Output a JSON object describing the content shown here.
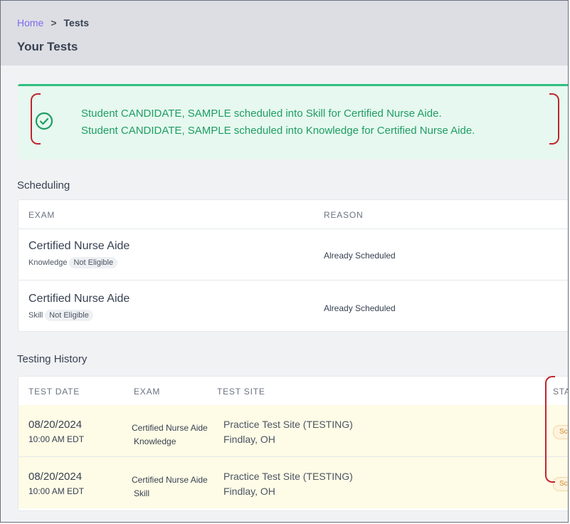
{
  "breadcrumb": {
    "home": "Home",
    "separator": ">",
    "current": "Tests"
  },
  "page_title": "Your Tests",
  "alert": {
    "icon": "check-circle-icon",
    "color": "#1f9d63",
    "messages": [
      "Student CANDIDATE, SAMPLE scheduled into Skill for Certified Nurse Aide.",
      "Student CANDIDATE, SAMPLE scheduled into Knowledge for Certified Nurse Aide."
    ]
  },
  "scheduling": {
    "title": "Scheduling",
    "headers": {
      "exam": "EXAM",
      "reason": "REASON"
    },
    "rows": [
      {
        "exam": "Certified Nurse Aide",
        "type": "Knowledge",
        "badge": "Not Eligible",
        "reason": "Already Scheduled"
      },
      {
        "exam": "Certified Nurse Aide",
        "type": "Skill",
        "badge": "Not Eligible",
        "reason": "Already Scheduled"
      }
    ]
  },
  "history": {
    "title": "Testing History",
    "headers": {
      "date": "TEST DATE",
      "exam": "EXAM",
      "site": "TEST SITE",
      "status": "STAT"
    },
    "rows": [
      {
        "date": "08/20/2024",
        "time": "10:00 AM EDT",
        "exam": "Certified Nurse Aide",
        "type": "Knowledge",
        "site": "Practice Test Site (TESTING)",
        "location": "Findlay, OH",
        "status": "Sch"
      },
      {
        "date": "08/20/2024",
        "time": "10:00 AM EDT",
        "exam": "Certified Nurse Aide",
        "type": "Skill",
        "site": "Practice Test Site (TESTING)",
        "location": "Findlay, OH",
        "status": "Sch"
      }
    ]
  },
  "colors": {
    "accent": "#7c6cf2",
    "success": "#2fbf7f",
    "highlight_row": "#fefbe6",
    "annotation": "#c0262d"
  }
}
